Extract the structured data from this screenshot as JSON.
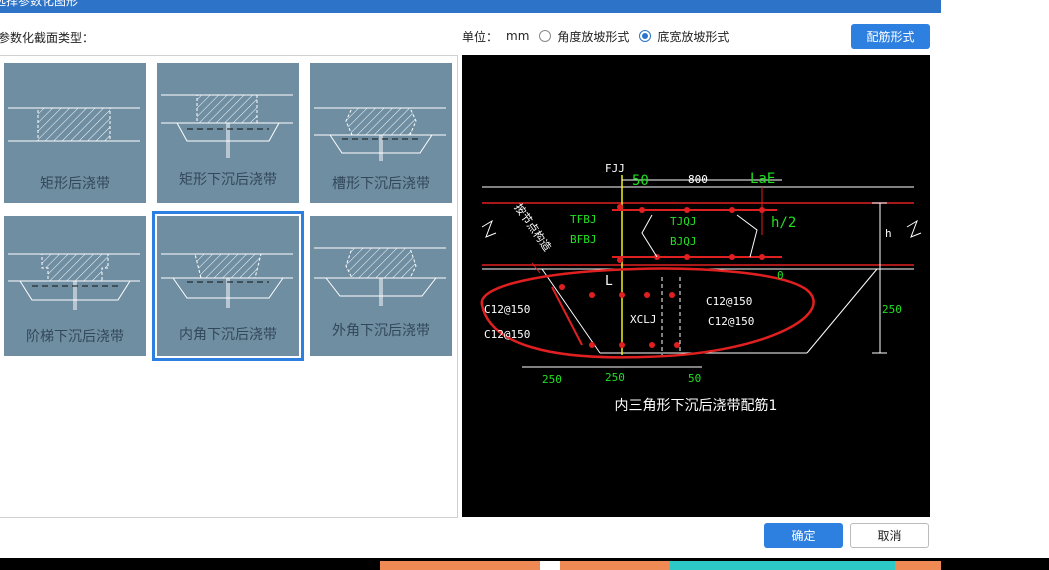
{
  "dialog": {
    "title": "选择参数化图形",
    "section_label": "参数化截面类型：",
    "unit_label": "单位：",
    "unit_value": "mm",
    "radio_options": [
      "角度放坡形式",
      "底宽放坡形式"
    ],
    "radio_selected_index": 1,
    "rebar_button": "配筋形式",
    "ok_button": "确定",
    "cancel_button": "取消"
  },
  "tiles": [
    {
      "label": "矩形后浇带"
    },
    {
      "label": "矩形下沉后浇带"
    },
    {
      "label": "槽形下沉后浇带"
    },
    {
      "label": "阶梯下沉后浇带"
    },
    {
      "label": "内角下沉后浇带"
    },
    {
      "label": "外角下沉后浇带"
    }
  ],
  "selected_tile_index": 4,
  "preview": {
    "caption": "内三角形下沉后浇带配筋1",
    "labels": {
      "fjj": "FJJ",
      "dim_50_top": "50",
      "dim_800": "800",
      "lae": "LaE",
      "tfbj": "TFBJ",
      "tjqj": "TJQJ",
      "h_half": "h/2",
      "h": "h",
      "bfbj": "BFBJ",
      "bjqj": "BJQJ",
      "diagonal_note": "按节点构造",
      "l": "L",
      "zero": "0",
      "c12_left_1": "C12@150",
      "c12_right_1": "C12@150",
      "xclj": "XCLJ",
      "c12_left_2": "C12@150",
      "c12_right_2": "C12@150",
      "dim_250_right": "250",
      "dim_250_a": "250",
      "dim_250_b": "250",
      "dim_50_bottom": "50"
    }
  },
  "colors": {
    "title_bar": "#2d73c8",
    "primary_button": "#2d7fe0",
    "tile_bg": "#6f8ea1",
    "annotation_red": "#e02020",
    "cad_green": "#20e020",
    "cad_yellow": "#f0f020"
  }
}
